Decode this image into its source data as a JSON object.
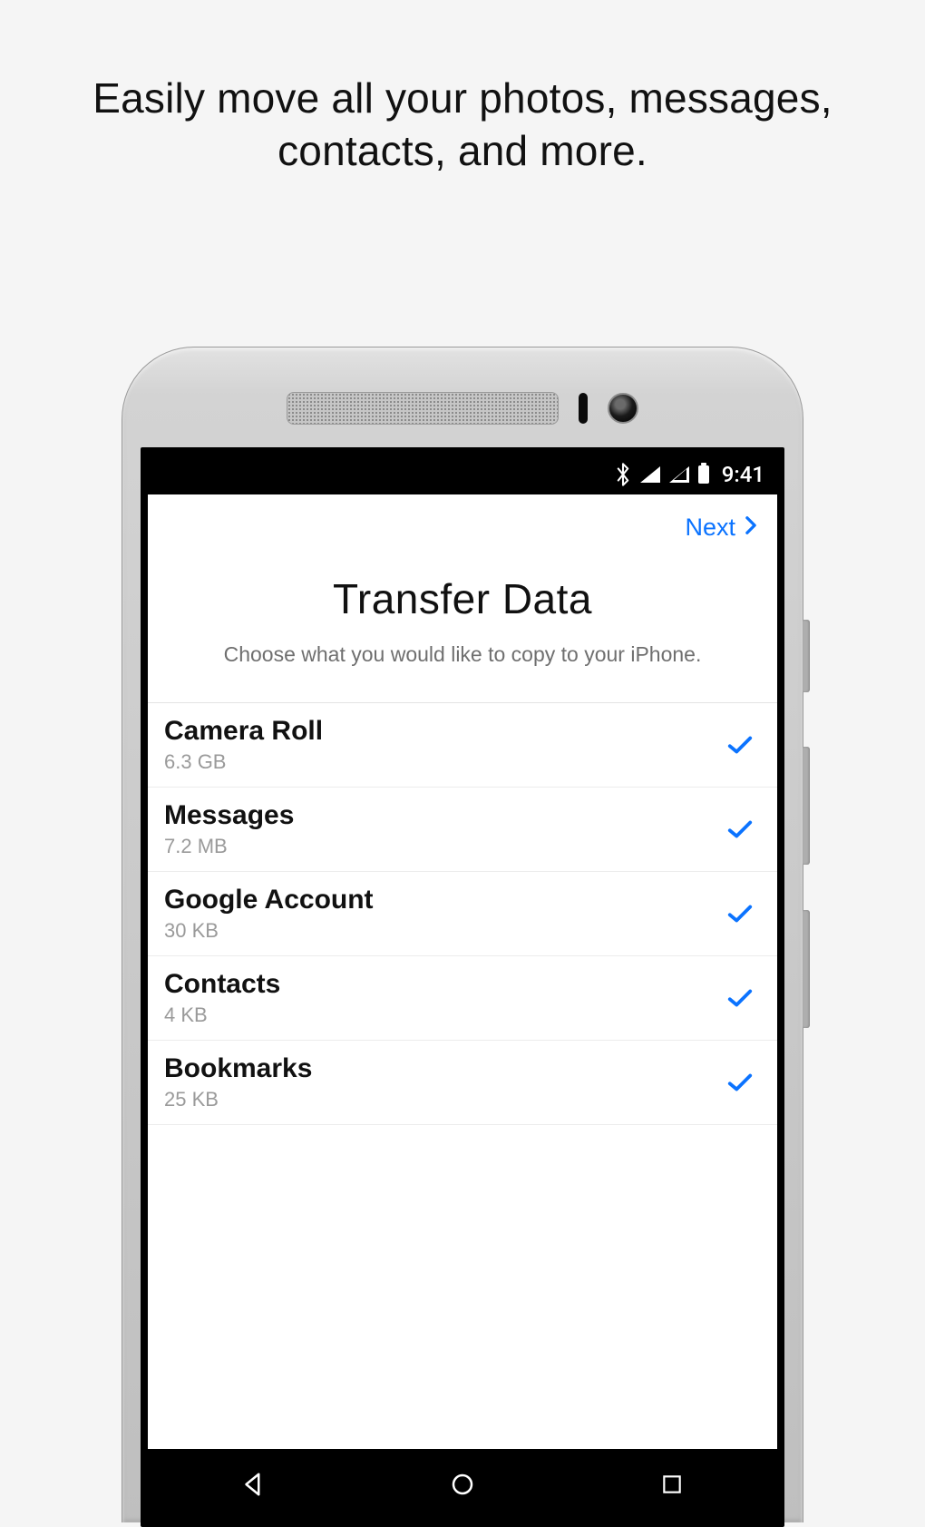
{
  "headline": "Easily move all your photos, messages, contacts, and more.",
  "statusbar": {
    "time": "9:41"
  },
  "topbar": {
    "next_label": "Next"
  },
  "screen": {
    "title": "Transfer Data",
    "subtitle": "Choose what you would like to copy to your iPhone."
  },
  "items": [
    {
      "name": "Camera Roll",
      "size": "6.3 GB",
      "checked": true
    },
    {
      "name": "Messages",
      "size": "7.2 MB",
      "checked": true
    },
    {
      "name": "Google Account",
      "size": "30 KB",
      "checked": true
    },
    {
      "name": "Contacts",
      "size": "4 KB",
      "checked": true
    },
    {
      "name": "Bookmarks",
      "size": "25 KB",
      "checked": true
    }
  ]
}
